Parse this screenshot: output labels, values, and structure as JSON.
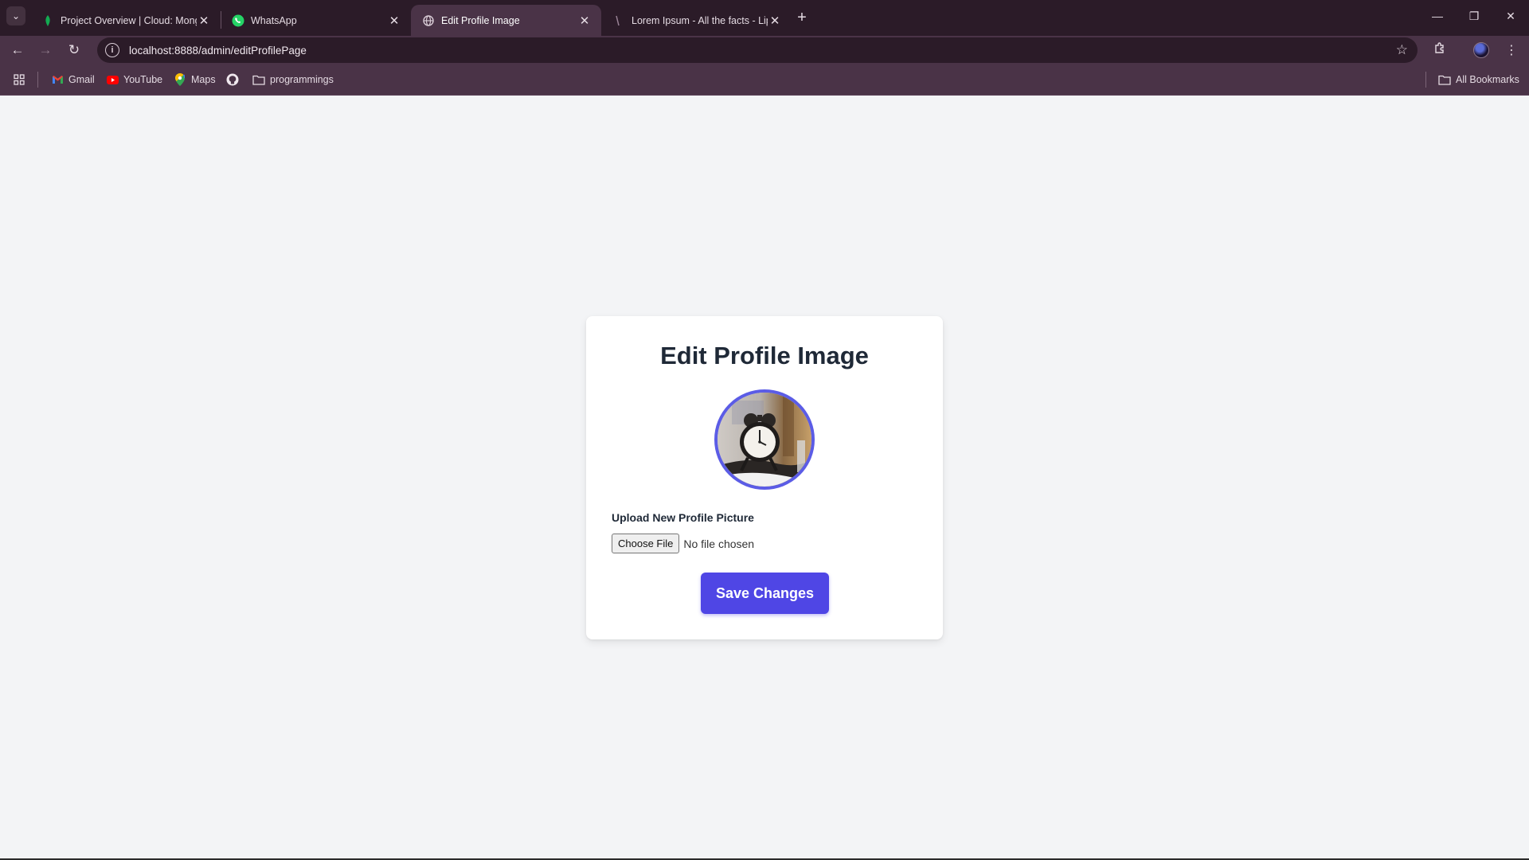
{
  "browser": {
    "tabs": [
      {
        "title": "Project Overview | Cloud: MongoDB",
        "favicon": "mongodb-leaf-icon",
        "active": false
      },
      {
        "title": "WhatsApp",
        "favicon": "whatsapp-icon",
        "active": false
      },
      {
        "title": "Edit Profile Image",
        "favicon": "globe-icon",
        "active": true
      },
      {
        "title": "Lorem Ipsum - All the facts - Lipsum",
        "favicon": "lipsum-icon",
        "active": false
      }
    ],
    "url": "localhost:8888/admin/editProfilePage",
    "bookmarks": [
      {
        "label": "Gmail",
        "icon": "gmail-icon"
      },
      {
        "label": "YouTube",
        "icon": "youtube-icon"
      },
      {
        "label": "Maps",
        "icon": "maps-icon"
      },
      {
        "label": "",
        "icon": "github-icon"
      },
      {
        "label": "programmings",
        "icon": "folder-icon"
      }
    ],
    "all_bookmarks_label": "All Bookmarks"
  },
  "page": {
    "title": "Edit Profile Image",
    "profile_image_alt": "alarm clock",
    "upload_label": "Upload New Profile Picture",
    "choose_file_label": "Choose File",
    "file_status": "No file chosen",
    "save_label": "Save Changes"
  },
  "colors": {
    "accent": "#4f46e5",
    "ring": "#5b5ce6",
    "heading": "#1f2937",
    "page_bg": "#f3f4f6",
    "chrome_dark": "#2b1b28",
    "chrome": "#4a3347"
  }
}
